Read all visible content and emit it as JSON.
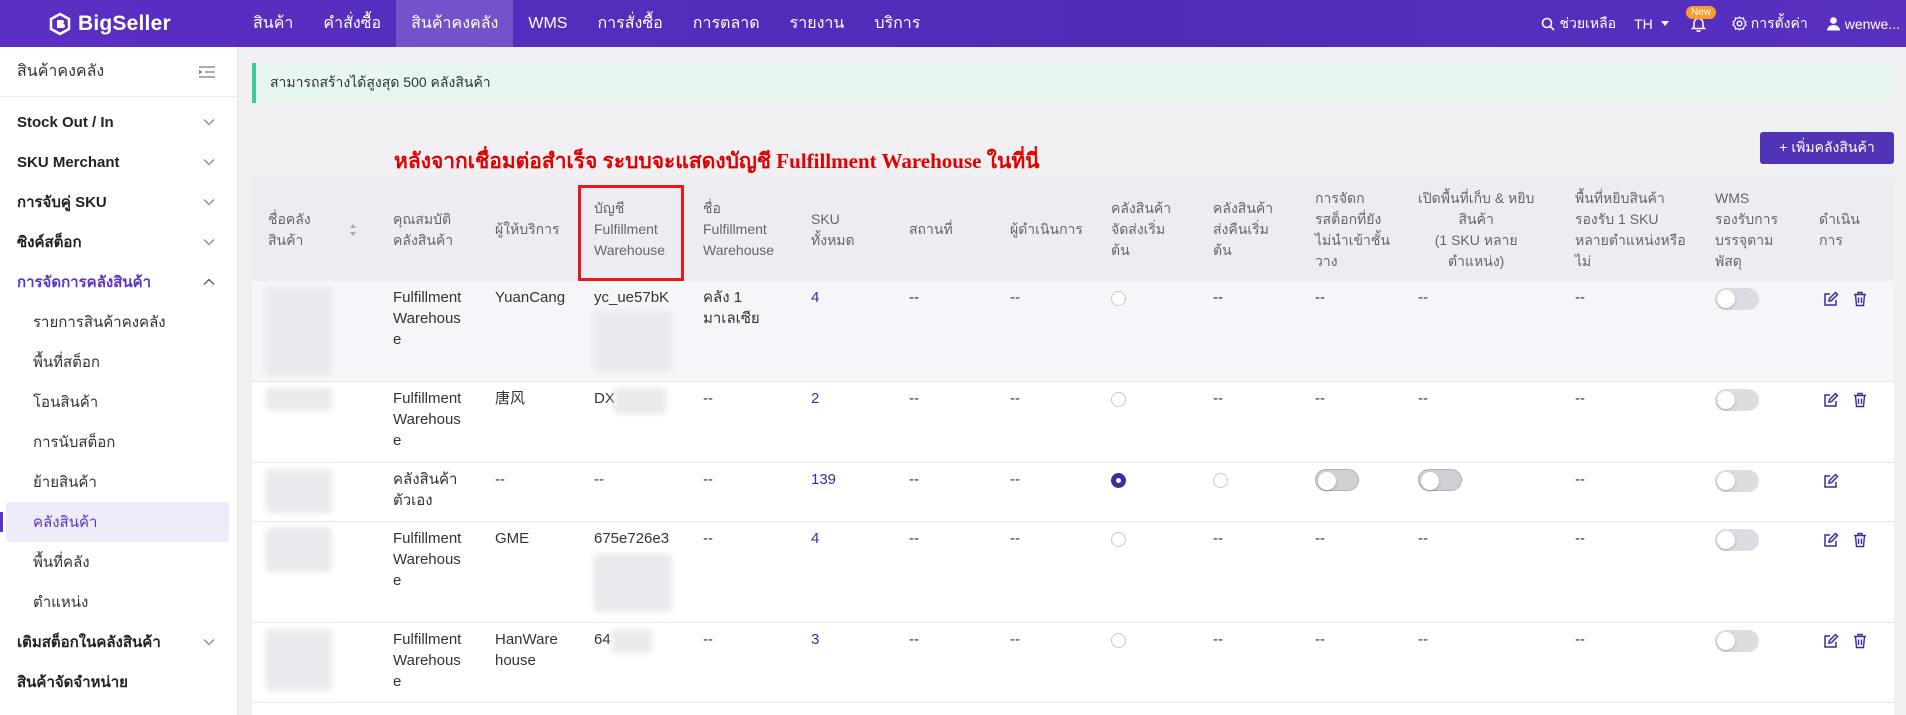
{
  "app": {
    "logo_text": "BigSeller"
  },
  "nav": {
    "items": [
      {
        "label": "สินค้า"
      },
      {
        "label": "คำสั่งซื้อ"
      },
      {
        "label": "สินค้าคงคลัง"
      },
      {
        "label": "WMS"
      },
      {
        "label": "การสั่งซื้อ"
      },
      {
        "label": "การตลาด"
      },
      {
        "label": "รายงาน"
      },
      {
        "label": "บริการ"
      }
    ],
    "active_index": 2
  },
  "topright": {
    "help": "ช่วยเหลือ",
    "lang": "TH",
    "new_badge": "New",
    "settings": "การตั้งค่า",
    "user": "wenwe..."
  },
  "sidebar": {
    "title": "สินค้าคงคลัง",
    "groups": [
      {
        "label": "Stock Out / In"
      },
      {
        "label": "SKU Merchant"
      },
      {
        "label": "การจับคู่ SKU"
      },
      {
        "label": "ซิงค์สต็อก"
      },
      {
        "label": "การจัดการคลังสินค้า"
      }
    ],
    "subitems": [
      {
        "label": "รายการสินค้าคงคลัง"
      },
      {
        "label": "พื้นที่สต็อก"
      },
      {
        "label": "โอนสินค้า"
      },
      {
        "label": "การนับสต็อก"
      },
      {
        "label": "ย้ายสินค้า"
      },
      {
        "label": "คลังสินค้า"
      },
      {
        "label": "พื้นที่คลัง"
      },
      {
        "label": "ตำแหน่ง"
      }
    ],
    "bottom_groups": [
      {
        "label": "เติมสต็อกในคลังสินค้า"
      },
      {
        "label": "สินค้าจัดจำหน่าย"
      }
    ]
  },
  "notice": "สามารถสร้างได้สูงสุด 500 คลังสินค้า",
  "annotation": "หลังจากเชื่อมต่อสำเร็จ ระบบจะแสดงบัญชี Fulfillment Warehouse ในที่นี่",
  "add_button": "+ เพิ่มคลังสินค้า",
  "table": {
    "headers": [
      "ชื่อคลัง\nสินค้า",
      "คุณสมบัติ\nคลังสินค้า",
      "ผู้ให้บริการ",
      "บัญชี\nFulfillment\nWarehouse",
      "ชื่อ\nFulfillment\nWarehouse",
      "SKU\nทั้งหมด",
      "สถานที่",
      "ผู้ดำเนินการ",
      "คลังสินค้า\nจัดส่งเริ่ม\nต้น",
      "คลังสินค้า\nส่งคืนเริ่ม\nต้น",
      "การจัดก\nรสต็อกที่ยัง\nไม่นำเข้าชั้น\nวาง",
      "เปิดพื้นที่เก็บ & หยิบ\nสินค้า\n(1 SKU หลาย\nตำแหน่ง)",
      "พื้นที่หยิบสินค้า\nรองรับ 1 SKU\nหลายตำแหน่งหรือ\nไม่",
      "WMS\nรองรับการ\nบรรจุตาม\nพัสดุ",
      "ดำเนิน\nการ"
    ],
    "rows": [
      {
        "attr": "Fulfillment\nWarehous\ne",
        "provider": "YuanCang",
        "account": "yc_ue57bK",
        "fw_name": "คลัง 1\nมาเลเซีย",
        "sku": "4",
        "location": "--",
        "operator": "--",
        "ship_default": "off",
        "return_default": "--",
        "unshelved": "--",
        "pick_area": "--",
        "pick_multi": "--"
      },
      {
        "attr": "Fulfillment\nWarehous\ne",
        "provider": "唐风",
        "account": "DX",
        "fw_name": "--",
        "sku": "2",
        "location": "--",
        "operator": "--",
        "ship_default": "off",
        "return_default": "--",
        "unshelved": "--",
        "pick_area": "--",
        "pick_multi": "--"
      },
      {
        "attr": "คลังสินค้า\nตัวเอง",
        "provider": "--",
        "account": "--",
        "fw_name": "--",
        "sku": "139",
        "location": "--",
        "operator": "--",
        "ship_default": "on",
        "return_default": "radio",
        "unshelved": "toggle",
        "pick_area": "toggle",
        "pick_multi": "--"
      },
      {
        "attr": "Fulfillment\nWarehous\ne",
        "provider": "GME",
        "account": "675e726e3",
        "fw_name": "--",
        "sku": "4",
        "location": "--",
        "operator": "--",
        "ship_default": "off",
        "return_default": "--",
        "unshelved": "--",
        "pick_area": "--",
        "pick_multi": "--"
      },
      {
        "attr": "Fulfillment\nWarehous\ne",
        "provider": "HanWare\nhouse",
        "account": "64",
        "fw_name": "--",
        "sku": "3",
        "location": "--",
        "operator": "--",
        "ship_default": "off",
        "return_default": "--",
        "unshelved": "--",
        "pick_area": "--",
        "pick_multi": "--"
      }
    ]
  },
  "colors": {
    "brand": "#5a2fc2",
    "accent": "#5133b5",
    "highlight_red": "#e81919",
    "notice_bg": "#e8f6f0"
  }
}
